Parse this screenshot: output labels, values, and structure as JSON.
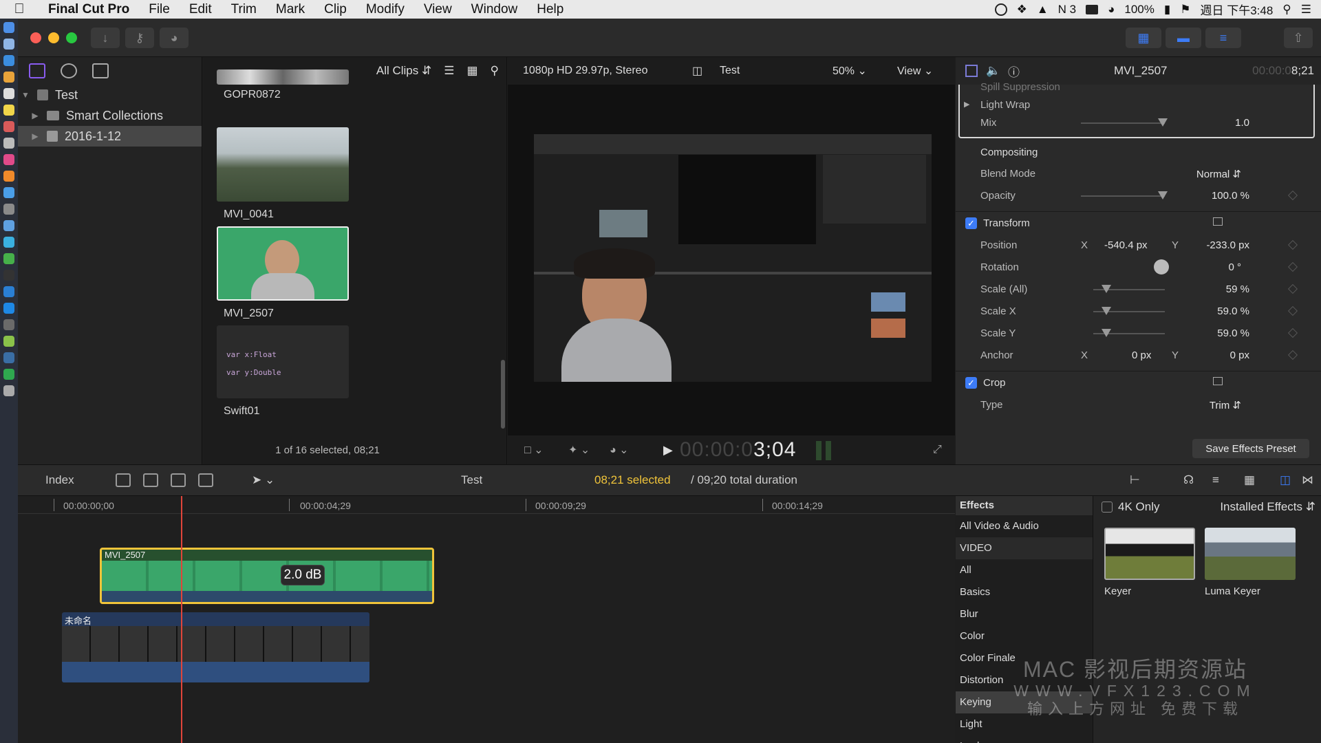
{
  "menubar": {
    "app_name": "Final Cut Pro",
    "menus": [
      "File",
      "Edit",
      "Trim",
      "Mark",
      "Clip",
      "Modify",
      "View",
      "Window",
      "Help"
    ],
    "status": {
      "notif_count": "3",
      "battery": "100%",
      "datetime": "週日 下午3:48"
    }
  },
  "library": {
    "name": "Test",
    "items": [
      {
        "label": "Smart Collections"
      },
      {
        "label": "2016-1-12"
      }
    ]
  },
  "browser": {
    "filter_label": "All Clips",
    "clips": [
      {
        "name": "GOPR0872"
      },
      {
        "name": "MVI_0041"
      },
      {
        "name": "MVI_2507"
      },
      {
        "name": "Swift01",
        "code_lines": [
          "var x:Float",
          "var y:Double"
        ]
      }
    ],
    "footer": "1 of 16 selected, 08;21"
  },
  "viewer": {
    "format": "1080p HD 29.97p, Stereo",
    "project": "Test",
    "zoom": "50%",
    "view_label": "View",
    "timecode_dim": "00:00:0",
    "timecode_bright": "3;04"
  },
  "inspector": {
    "clip_name": "MVI_2507",
    "duration_dim": "00:00:0",
    "duration_bright": "8;21",
    "rows": {
      "spill": "Spill Suppression",
      "light_wrap": "Light Wrap",
      "mix_label": "Mix",
      "mix_value": "1.0",
      "compositing": "Compositing",
      "blend_label": "Blend Mode",
      "blend_value": "Normal",
      "opacity_label": "Opacity",
      "opacity_value": "100.0",
      "transform": "Transform",
      "position_label": "Position",
      "pos_x": "-540.4",
      "pos_y": "-233.0",
      "rotation_label": "Rotation",
      "rotation_value": "0",
      "scale_all_label": "Scale (All)",
      "scale_all_value": "59",
      "scale_x_label": "Scale X",
      "scale_x_value": "59.0",
      "scale_y_label": "Scale Y",
      "scale_y_value": "59.0",
      "anchor_label": "Anchor",
      "anchor_x": "0",
      "anchor_y": "0",
      "crop": "Crop",
      "type_label": "Type",
      "type_value": "Trim"
    },
    "units": {
      "px": "px",
      "pct": "%",
      "deg": "°",
      "x": "X",
      "y": "Y"
    },
    "save_preset": "Save Effects Preset"
  },
  "timeline_bar": {
    "index_label": "Index",
    "project": "Test",
    "selected": "08;21 selected",
    "total": "/ 09;20 total duration"
  },
  "timeline": {
    "ruler": [
      "00:00:00;00",
      "00:00:04;29",
      "00:00:09;29",
      "00:00:14;29"
    ],
    "clip1_name": "MVI_2507",
    "clip2_name": "未命名",
    "volume_tip": "2.0 dB"
  },
  "effects": {
    "header": "Effects",
    "categories": [
      "All Video & Audio",
      "VIDEO",
      "All",
      "Basics",
      "Blur",
      "Color",
      "Color Finale",
      "Distortion",
      "Keying",
      "Light",
      "Looks"
    ],
    "four_k_only": "4K Only",
    "installed": "Installed Effects",
    "items": [
      {
        "name": "Keyer"
      },
      {
        "name": "Luma Keyer"
      }
    ]
  },
  "watermark": {
    "line1": "MAC 影视后期资源站",
    "line2": "WWW.VFX123.COM",
    "line3": "输入上方网址 免费下载"
  },
  "colors": {
    "accent": "#3d7cf7",
    "selection_border": "#f0c43a",
    "playhead": "#e0453a",
    "keying_green": "#3aa66a"
  }
}
